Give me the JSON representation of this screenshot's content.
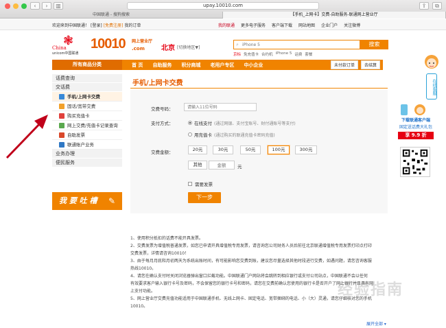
{
  "browser": {
    "url": "upay.10010.com",
    "tabs": [
      "中国联通 - 搜狗搜索",
      "【手机_上网卡】交费-自助服务-联通网上营业厅"
    ]
  },
  "toplinks": {
    "welcome": "欢迎来到中国联通！",
    "login": "[登录]",
    "register": "[免费注册]",
    "my_orders": "我的订单",
    "items": [
      "我的联通",
      "更多电子服务",
      "客户端下载",
      "网站地图",
      "企业门户",
      "关注微博"
    ]
  },
  "header": {
    "logo_en1": "China",
    "logo_en2": "unicom中国联通",
    "logo_num": "10010",
    "logo_com": ".com",
    "logo_sub": "网上营业厅",
    "city": "北京",
    "city_switch": "[切换地区▼]",
    "search_placeholder": "iPhone 5",
    "search_button": "搜索",
    "hot_label": "京标",
    "hot_items": [
      "免充值卡",
      "合约机",
      "iPhone 5",
      "话费",
      "套餐"
    ]
  },
  "nav": {
    "all_categories": "所有商品分类",
    "items": [
      "首 页",
      "自助服务",
      "积分商城",
      "老用户专区",
      "中小企业"
    ],
    "trade": "未付款订单",
    "cart": "去结算"
  },
  "sidebar": {
    "sections": {
      "bill": "话费查询",
      "pay": "交话费",
      "business": "业务办理",
      "convenience": "便民服务"
    },
    "items": [
      "手机/上网卡交费",
      "固话/宽带交费",
      "购买充值卡",
      "网上交费/充值卡记录查询",
      "自助发票",
      "联通账户业务"
    ],
    "complain": "我 要 吐 槽"
  },
  "main": {
    "title": "手机/上网卡交费",
    "phone_label": "交费号码：",
    "phone_placeholder": "请输入11位号码",
    "method_label": "支付方式：",
    "method_online": "在线支付",
    "method_online_desc": "(通过网银、支付宝账号、财付通账号等支付)",
    "method_card": "用充值卡",
    "method_card_desc": "(通过购买的联通充值卡密码充值)",
    "amount_label": "交费金额：",
    "amounts": [
      "20元",
      "30元",
      "50元",
      "100元",
      "300元"
    ],
    "other": "其他",
    "amount_placeholder": "金额",
    "yuan": "元",
    "invoice": "需要发票",
    "next": "下一步"
  },
  "notes": [
    "1、使用积分抵扣的话费不能开具发票。",
    "2、交费发票为增值税普通发票，如您已申请开具增值税专用发票，请咨询您公司财务人员后前往北京联通增值税专用发票打印点打印",
    "交费发票，详情请咨询10010！",
    "3、由于每月月底和月初两天为系统出账时间，有可能影响您交费到账，建议您尽量选择其他时段进行交费，如遇问题，请您咨询客服",
    "热线10010。",
    "4、请您在确认支付时关闭浏览器弹出窗口拦截功能。中国联通门户网站将会跳转到相应银行或支付公司站点，中国联通不会以任何",
    "有效要求客户输入银行卡号及密码，不会保留您的银行卡号和密码，请您在交费前确认您使用的银行卡是否开户了网上银行并且具有网",
    "上支付功能。",
    "5、网上营业厅交费充值功能适用于中国联通手机、无线上网卡、固定电话、宽带捆绑的电话、小（大）灵通，请您仔细核对您的手机",
    "10010。"
  ],
  "expand": "展开全部 ▾",
  "right": {
    "cs_badge": "在线客服",
    "promo_title": "下载联通客户端",
    "promo_sub": "固定送话费大礼包",
    "promo_price": "享 9.9 折"
  },
  "watermark": "经验指南",
  "colors": {
    "brand_orange": "#f08300",
    "brand_red": "#e60012"
  }
}
